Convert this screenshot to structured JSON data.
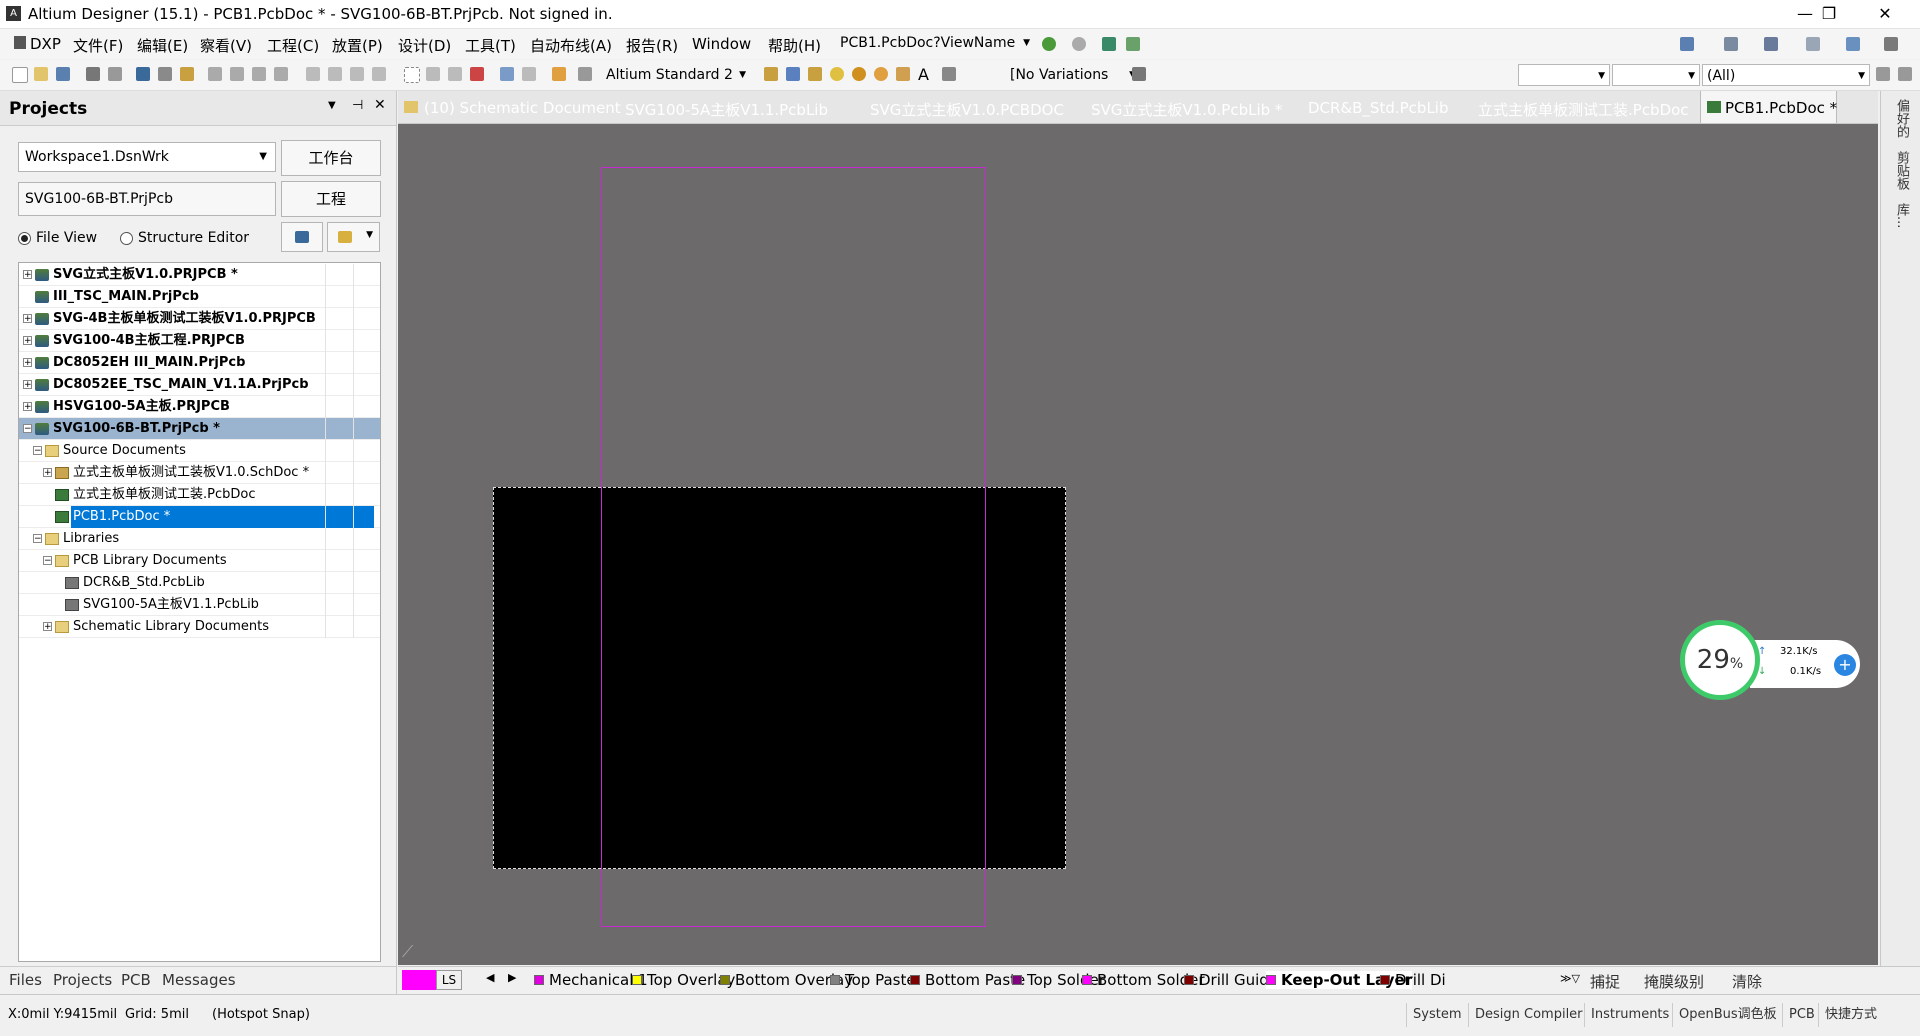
{
  "window": {
    "title": "Altium Designer (15.1) - PCB1.PcbDoc * - SVG100-6B-BT.PrjPcb. Not signed in.",
    "minimize": "—",
    "restore": "❐",
    "close": "✕"
  },
  "menu": {
    "items": [
      "DXP",
      "文件(F)",
      "编辑(E)",
      "察看(V)",
      "工程(C)",
      "放置(P)",
      "设计(D)",
      "工具(T)",
      "自动布线(A)",
      "报告(R)",
      "Window",
      "帮助(H)"
    ],
    "view_name": "PCB1.PcbDoc?ViewName"
  },
  "toolbar": {
    "standard_select": "Altium Standard 2",
    "variations_select": "[No Variations",
    "filter_select": "(All)"
  },
  "projects": {
    "title": "Projects",
    "workspace": "Workspace1.DsnWrk",
    "workspace_btn": "工作台",
    "project": "SVG100-6B-BT.PrjPcb",
    "project_btn": "工程",
    "file_view": "File View",
    "structure_editor": "Structure Editor",
    "tree": [
      {
        "label": "SVG立式主板V1.0.PRJPCB *",
        "bold": true,
        "level": 0,
        "type": "proj",
        "exp": "+"
      },
      {
        "label": "III_TSC_MAIN.PrjPcb",
        "bold": true,
        "level": 0,
        "type": "proj",
        "exp": ""
      },
      {
        "label": "SVG-4B主板单板测试工装板V1.0.PRJPCB",
        "bold": true,
        "level": 0,
        "type": "proj",
        "exp": "+"
      },
      {
        "label": "SVG100-4B主板工程.PRJPCB",
        "bold": true,
        "level": 0,
        "type": "proj",
        "exp": "+"
      },
      {
        "label": "DC8052EH III_MAIN.PrjPcb",
        "bold": true,
        "level": 0,
        "type": "proj",
        "exp": "+"
      },
      {
        "label": "DC8052EE_TSC_MAIN_V1.1A.PrjPcb",
        "bold": true,
        "level": 0,
        "type": "proj",
        "exp": "+"
      },
      {
        "label": "HSVG100-5A主板.PRJPCB",
        "bold": true,
        "level": 0,
        "type": "proj",
        "exp": "+"
      },
      {
        "label": "SVG100-6B-BT.PrjPcb *",
        "bold": true,
        "level": 0,
        "type": "proj",
        "exp": "−",
        "selected_gray": true
      },
      {
        "label": "Source Documents",
        "bold": false,
        "level": 1,
        "type": "folder",
        "exp": "−"
      },
      {
        "label": "立式主板单板测试工装板V1.0.SchDoc *",
        "bold": false,
        "level": 2,
        "type": "sch",
        "exp": "+"
      },
      {
        "label": "立式主板单板测试工装.PcbDoc",
        "bold": false,
        "level": 2,
        "type": "pcb",
        "exp": ""
      },
      {
        "label": "PCB1.PcbDoc *",
        "bold": false,
        "level": 2,
        "type": "pcb",
        "exp": "",
        "selected_blue": true
      },
      {
        "label": "Libraries",
        "bold": false,
        "level": 1,
        "type": "folder",
        "exp": "−"
      },
      {
        "label": "PCB Library Documents",
        "bold": false,
        "level": 2,
        "type": "folder",
        "exp": "−"
      },
      {
        "label": "DCR&B_Std.PcbLib",
        "bold": false,
        "level": 3,
        "type": "lib",
        "exp": ""
      },
      {
        "label": "SVG100-5A主板V1.1.PcbLib",
        "bold": false,
        "level": 3,
        "type": "lib",
        "exp": ""
      },
      {
        "label": "Schematic Library Documents",
        "bold": false,
        "level": 2,
        "type": "folder",
        "exp": "+"
      }
    ],
    "bottom_tabs": [
      "Files",
      "Projects",
      "PCB",
      "Messages"
    ]
  },
  "doc_tabs": [
    {
      "label": "(10) Schematic Document",
      "x": 0
    },
    {
      "label": "SVG100-5A主板V1.1.PcbLib",
      "x": 0
    },
    {
      "label": "SVG立式主板V1.0.PCBDOC",
      "x": 0
    },
    {
      "label": "SVG立式主板V1.0.PcbLib *",
      "x": 0
    },
    {
      "label": "DCR&B_Std.PcbLib",
      "x": 0
    },
    {
      "label": "立式主板单板测试工装.PcbDoc",
      "x": 0
    },
    {
      "label": "PCB1.PcbDoc *",
      "x": 0
    }
  ],
  "right_tabs": [
    "偏好的",
    "剪贴板",
    "库..."
  ],
  "network": {
    "percent": "29",
    "percent_unit": "%",
    "up": "32.1K/s",
    "down": "0.1K/s"
  },
  "layer_bar": {
    "current": "LS",
    "layers": [
      {
        "name": "Mechanical 1",
        "color": "#e000e0",
        "bold": false
      },
      {
        "name": "Top Overlay",
        "color": "#ffff00",
        "bold": false
      },
      {
        "name": "Bottom Overlay",
        "color": "#808000",
        "bold": false
      },
      {
        "name": "Top Paste",
        "color": "#808080",
        "bold": false
      },
      {
        "name": "Bottom Paste",
        "color": "#800000",
        "bold": false
      },
      {
        "name": "Top Solder",
        "color": "#800080",
        "bold": false
      },
      {
        "name": "Bottom Solder",
        "color": "#ff00ff",
        "bold": false
      },
      {
        "name": "Drill Guide",
        "color": "#800000",
        "bold": false
      },
      {
        "name": "Keep-Out Layer",
        "color": "#ff00ff",
        "bold": true
      },
      {
        "name": "Drill Di",
        "color": "#800000",
        "bold": false
      }
    ],
    "snap": "捕捉",
    "mask": "掩膜级别",
    "clear": "清除"
  },
  "status": {
    "coords": "X:0mil Y:9415mil",
    "grid": "Grid: 5mil",
    "snap": "(Hotspot Snap)",
    "buttons": [
      "System",
      "Design Compiler",
      "Instruments",
      "OpenBus调色板",
      "PCB",
      "快捷方式"
    ]
  },
  "colors": {
    "canvas": "#6d6a6b",
    "board": "#000000",
    "keepout": "#c62ad0",
    "selection": "#0078d7",
    "selected_gray": "#9ab3cf"
  }
}
